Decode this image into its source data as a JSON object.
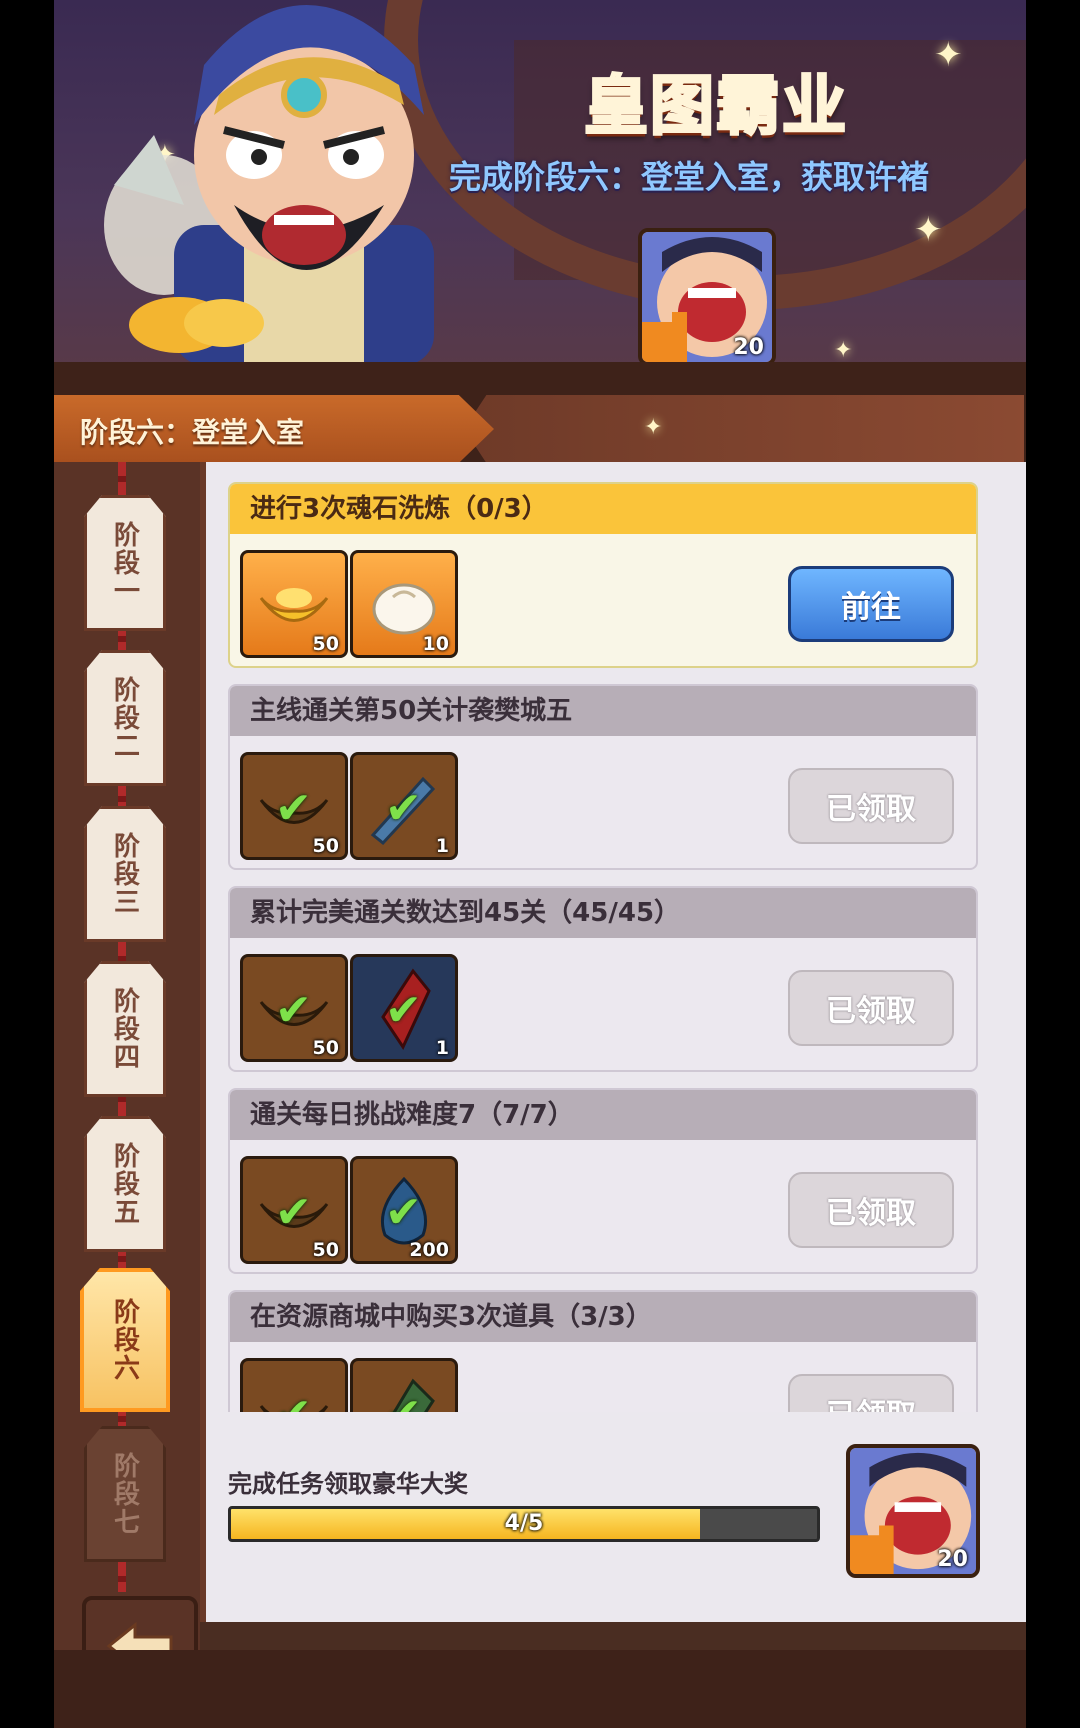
{
  "header": {
    "title": "皇图霸业",
    "subtitle": "完成阶段六：登堂入室，获取许褚",
    "reward_count": "20"
  },
  "stage_header": {
    "label": "阶段六：登堂入室"
  },
  "sidebar": {
    "tabs": [
      {
        "label": "阶段一",
        "state": "normal"
      },
      {
        "label": "阶段二",
        "state": "normal"
      },
      {
        "label": "阶段三",
        "state": "normal"
      },
      {
        "label": "阶段四",
        "state": "normal"
      },
      {
        "label": "阶段五",
        "state": "normal"
      },
      {
        "label": "阶段六",
        "state": "active"
      },
      {
        "label": "阶段七",
        "state": "locked"
      }
    ]
  },
  "tasks": [
    {
      "title": "进行3次魂石洗炼（0/3）",
      "button": "前往",
      "state": "active",
      "items": [
        {
          "icon": "gold-ingot-icon",
          "count": "50"
        },
        {
          "icon": "steamed-bun-icon",
          "count": "10"
        }
      ]
    },
    {
      "title": "主线通关第50关计袭樊城五",
      "button": "已领取",
      "state": "claimed",
      "items": [
        {
          "icon": "gold-ingot-icon",
          "count": "50"
        },
        {
          "icon": "weapon-icon",
          "count": "1"
        }
      ]
    },
    {
      "title": "累计完美通关数达到45关（45/45）",
      "button": "已领取",
      "state": "claimed",
      "items": [
        {
          "icon": "gold-ingot-icon",
          "count": "50"
        },
        {
          "icon": "red-gem-icon",
          "count": "1"
        }
      ]
    },
    {
      "title": "通关每日挑战难度7（7/7）",
      "button": "已领取",
      "state": "claimed",
      "items": [
        {
          "icon": "gold-ingot-icon",
          "count": "50"
        },
        {
          "icon": "blue-flame-icon",
          "count": "200"
        }
      ]
    },
    {
      "title": "在资源商城中购买3次道具（3/3）",
      "button": "已领取",
      "state": "claimed",
      "items": [
        {
          "icon": "gold-ingot-icon",
          "count": ""
        },
        {
          "icon": "green-item-icon",
          "count": ""
        }
      ]
    }
  ],
  "footer": {
    "text": "完成任务领取豪华大奖",
    "progress_text": "4/5",
    "progress_fraction": 0.8,
    "reward_count": "20"
  },
  "colors": {
    "accent_orange": "#f59a2a",
    "active_header": "#fac43a",
    "go_button": "#3a7ad8"
  }
}
